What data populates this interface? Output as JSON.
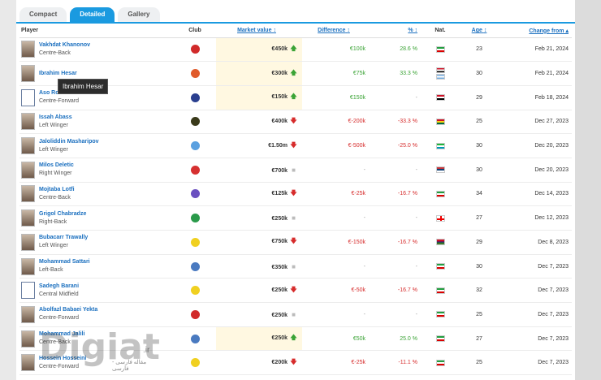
{
  "tabs": [
    {
      "label": "Compact",
      "active": false
    },
    {
      "label": "Detailed",
      "active": true
    },
    {
      "label": "Gallery",
      "active": false
    }
  ],
  "columns": {
    "player": "Player",
    "club": "Club",
    "market_value": "Market value",
    "difference": "Difference",
    "pct": "%",
    "nat": "Nat.",
    "age": "Age",
    "change_from": "Change from"
  },
  "tooltip": "Ibrahim Hesar",
  "rows": [
    {
      "name": "Vakhdat Khanonov",
      "position": "Centre-Back",
      "club_color": "#d12a2a",
      "market_value": "€450k",
      "trend": "up",
      "difference": "€100k",
      "pct": "28.6 %",
      "nat": [
        "iran"
      ],
      "age": "23",
      "change_from": "Feb 21, 2024"
    },
    {
      "name": "Ibrahim Hesar",
      "position": "",
      "club_color": "#e05a2a",
      "market_value": "€300k",
      "trend": "up",
      "difference": "€75k",
      "pct": "33.3 %",
      "nat": [
        "iraq",
        "argentina"
      ],
      "age": "30",
      "change_from": "Feb 21, 2024"
    },
    {
      "name": "Aso Rostam",
      "position": "Centre-Forward",
      "club_color": "#2a3f8f",
      "market_value": "€150k",
      "trend": "up",
      "difference": "€150k",
      "pct": "-",
      "nat": [
        "egypt"
      ],
      "age": "29",
      "change_from": "Feb 18, 2024"
    },
    {
      "name": "Issah Abass",
      "position": "Left Winger",
      "club_color": "#3a3a1a",
      "market_value": "€400k",
      "trend": "down",
      "difference": "€-200k",
      "pct": "-33.3 %",
      "nat": [
        "ghana"
      ],
      "age": "25",
      "change_from": "Dec 27, 2023"
    },
    {
      "name": "Jaloliddin Masharipov",
      "position": "Left Winger",
      "club_color": "#5aa0e0",
      "market_value": "€1.50m",
      "trend": "down",
      "difference": "€-500k",
      "pct": "-25.0 %",
      "nat": [
        "uzbekistan"
      ],
      "age": "30",
      "change_from": "Dec 20, 2023"
    },
    {
      "name": "Milos Deletic",
      "position": "Right Winger",
      "club_color": "#d63030",
      "market_value": "€700k",
      "trend": "flat",
      "difference": "-",
      "pct": "-",
      "nat": [
        "serbia"
      ],
      "age": "30",
      "change_from": "Dec 20, 2023"
    },
    {
      "name": "Mojtaba Lotfi",
      "position": "Centre-Back",
      "club_color": "#6a4fc0",
      "market_value": "€125k",
      "trend": "down",
      "difference": "€-25k",
      "pct": "-16.7 %",
      "nat": [
        "iran"
      ],
      "age": "34",
      "change_from": "Dec 14, 2023"
    },
    {
      "name": "Grigol Chabradze",
      "position": "Right-Back",
      "club_color": "#2a9a4a",
      "market_value": "€250k",
      "trend": "flat",
      "difference": "-",
      "pct": "-",
      "nat": [
        "georgia"
      ],
      "age": "27",
      "change_from": "Dec 12, 2023"
    },
    {
      "name": "Bubacarr Trawally",
      "position": "Left Winger",
      "club_color": "#f0d020",
      "market_value": "€750k",
      "trend": "down",
      "difference": "€-150k",
      "pct": "-16.7 %",
      "nat": [
        "gambia"
      ],
      "age": "29",
      "change_from": "Dec 8, 2023"
    },
    {
      "name": "Mohammad Sattari",
      "position": "Left-Back",
      "club_color": "#4a7ac0",
      "market_value": "€350k",
      "trend": "flat",
      "difference": "-",
      "pct": "-",
      "nat": [
        "iran"
      ],
      "age": "30",
      "change_from": "Dec 7, 2023"
    },
    {
      "name": "Sadegh Barani",
      "position": "Central Midfield",
      "club_color": "#f0d020",
      "market_value": "€250k",
      "trend": "down",
      "difference": "€-50k",
      "pct": "-16.7 %",
      "nat": [
        "iran"
      ],
      "age": "32",
      "change_from": "Dec 7, 2023"
    },
    {
      "name": "Abolfazl Babaei Yekta",
      "position": "Centre-Forward",
      "club_color": "#d12a2a",
      "market_value": "€250k",
      "trend": "flat",
      "difference": "-",
      "pct": "-",
      "nat": [
        "iran"
      ],
      "age": "25",
      "change_from": "Dec 7, 2023"
    },
    {
      "name": "Mohammad Jalili",
      "position": "Centre-Back",
      "club_color": "#4a7ac0",
      "market_value": "€250k",
      "trend": "up",
      "difference": "€50k",
      "pct": "25.0 %",
      "nat": [
        "iran"
      ],
      "age": "27",
      "change_from": "Dec 7, 2023"
    },
    {
      "name": "Hossein Hosseini",
      "position": "Centre-Forward",
      "club_color": "#f0d020",
      "market_value": "€200k",
      "trend": "down",
      "difference": "€-25k",
      "pct": "-11.1 %",
      "nat": [
        "iran"
      ],
      "age": "25",
      "change_from": "Dec 7, 2023"
    }
  ],
  "watermark": {
    "big": "Digiat",
    "suffix": ".ir",
    "tagline": "مقاله فارسی - فارسی"
  }
}
